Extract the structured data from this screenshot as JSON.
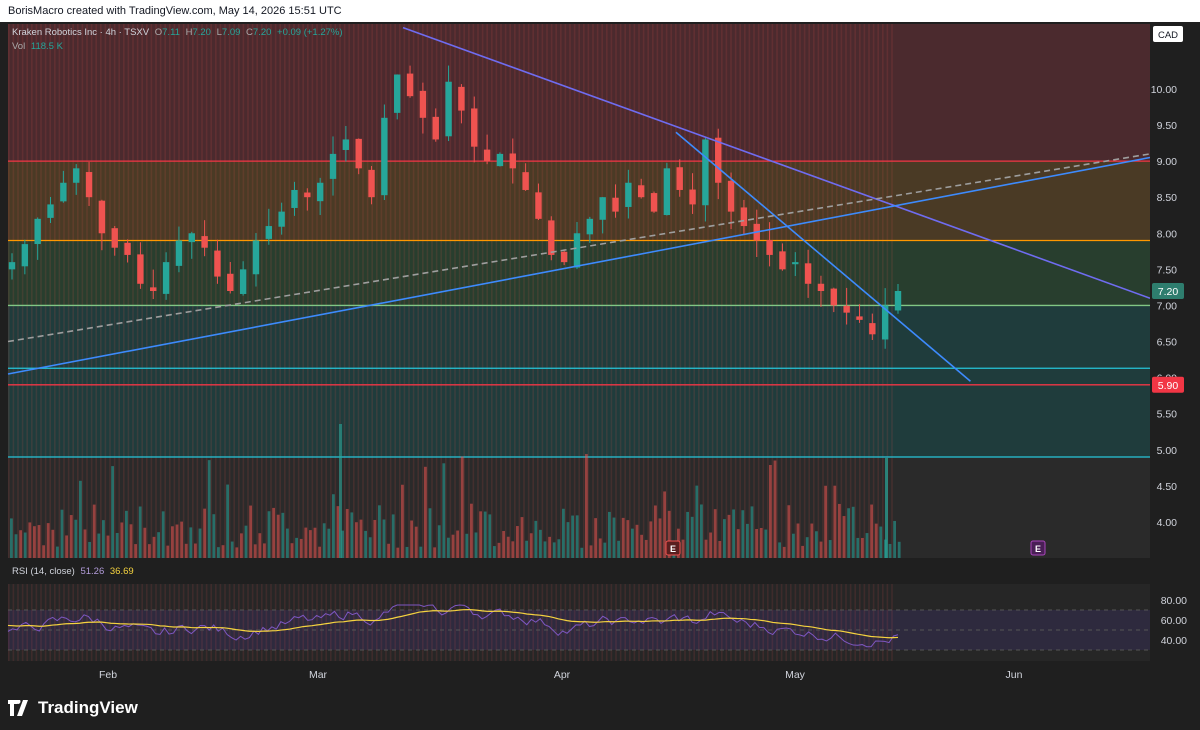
{
  "header": {
    "attribution": "BorisMacro created with TradingView.com, May 14, 2026 15:51 UTC"
  },
  "legend": {
    "symbol": "Kraken Robotics Inc · 4h · TSXV",
    "open_label": "O",
    "open": "7.11",
    "high_label": "H",
    "high": "7.20",
    "low_label": "L",
    "low": "7.09",
    "close_label": "C",
    "close": "7.20",
    "change": "+0.09 (+1.27%)",
    "vol_label": "Vol",
    "vol": "118.5 K"
  },
  "rsi_legend": {
    "label": "RSI (14, close)",
    "rsi": "51.26",
    "ma": "36.69"
  },
  "currency": "CAD",
  "price_labels": {
    "last": "7.20",
    "support": "5.90"
  },
  "footer": {
    "brand": "TradingView"
  },
  "colors": {
    "up": "#26a69a",
    "down": "#ef5350",
    "zone_top": "#4b2a2e",
    "zone_orange": "#4a3a25",
    "zone_green": "#283e2e",
    "zone_teal": "#1f3c3c",
    "zone_blue": "#1e3a3e",
    "rsi_line": "#7e57c2",
    "rsi_ma": "#f5d33f",
    "trend_blue": "#3d8bfd",
    "trend_violet": "#6f6cf0"
  },
  "chart_data": [
    {
      "type": "candlestick",
      "title": "Kraken Robotics Inc · 4h · TSXV",
      "y_axis_label": "CAD",
      "ylim": [
        3.5,
        10.9
      ],
      "y_ticks": [
        "10.00",
        "9.50",
        "9.00",
        "8.50",
        "8.00",
        "7.50",
        "7.00",
        "6.50",
        "6.00",
        "5.50",
        "5.00",
        "4.50",
        "4.00"
      ],
      "x_ticks": [
        "Feb",
        "Mar",
        "Apr",
        "May",
        "Jun"
      ],
      "x_range": [
        "2026-01-14",
        "2026-06-22"
      ],
      "candles_close": [
        7.6,
        7.85,
        8.2,
        8.4,
        8.7,
        8.9,
        8.5,
        8.0,
        7.8,
        7.7,
        7.3,
        7.2,
        7.6,
        7.9,
        8.0,
        7.8,
        7.4,
        7.2,
        7.5,
        7.9,
        8.1,
        8.3,
        8.6,
        8.5,
        8.7,
        9.1,
        9.3,
        8.9,
        8.5,
        9.6,
        10.2,
        9.9,
        9.6,
        9.3,
        10.1,
        9.7,
        9.2,
        9.0,
        9.1,
        8.9,
        8.6,
        8.2,
        7.7,
        7.6,
        8.0,
        8.2,
        8.5,
        8.3,
        8.7,
        8.5,
        8.3,
        8.9,
        8.6,
        8.4,
        9.3,
        8.7,
        8.3,
        8.1,
        7.9,
        7.7,
        7.5,
        7.6,
        7.3,
        7.2,
        7.0,
        6.9,
        6.8,
        6.6,
        7.0,
        7.2
      ],
      "trendlines": [
        {
          "name": "descending trendline",
          "from": [
            "2026-03-10",
            10.85
          ],
          "to": [
            "2026-06-22",
            7.1
          ]
        },
        {
          "name": "steep descending line",
          "from": [
            "2026-04-17",
            9.4
          ],
          "to": [
            "2026-05-28",
            5.95
          ]
        },
        {
          "name": "ascending trendline",
          "from": [
            "2026-01-14",
            6.05
          ],
          "to": [
            "2026-06-22",
            9.05
          ]
        },
        {
          "name": "dashed ascending line",
          "from": [
            "2026-01-14",
            6.5
          ],
          "to": [
            "2026-06-22",
            9.1
          ],
          "dashed": true
        }
      ],
      "horizontal_levels": [
        {
          "value": 9.0,
          "color": "#f23645"
        },
        {
          "value": 7.9,
          "color": "#ff9800"
        },
        {
          "value": 7.0,
          "color": "#81c784"
        },
        {
          "value": 6.13,
          "color": "#26c6da"
        },
        {
          "value": 5.9,
          "color": "#f23645"
        },
        {
          "value": 4.9,
          "color": "#26c6da"
        }
      ],
      "last_price": 7.2,
      "volume": "118.5 K"
    },
    {
      "type": "line",
      "title": "RSI (14, close)",
      "ylim": [
        25,
        90
      ],
      "y_ticks": [
        "80.00",
        "60.00",
        "40.00"
      ],
      "series": [
        {
          "name": "RSI",
          "value_last": 51.26
        },
        {
          "name": "RSI-based MA",
          "value_last": 36.69
        }
      ]
    }
  ]
}
